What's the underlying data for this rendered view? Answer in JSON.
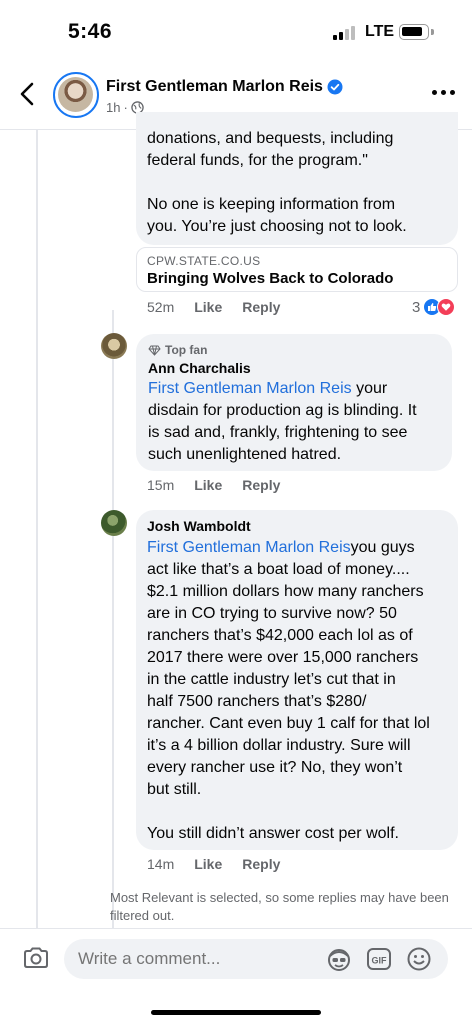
{
  "status_bar": {
    "time": "5:46",
    "network": "LTE"
  },
  "post_header": {
    "author": "First Gentleman Marlon Reis",
    "time": "1h",
    "separator": "·",
    "icons": {
      "back": "chevron-left-icon",
      "verified": "verified-badge-icon",
      "audience": "globe-icon",
      "more": "more-horizontal-icon"
    }
  },
  "comments": [
    {
      "text_lines": [
        "donations, and bequests, including",
        "federal funds, for the program.\"",
        "",
        "No one is keeping information from",
        "you. You’re just choosing not to look."
      ],
      "link_preview": {
        "domain": "CPW.STATE.CO.US",
        "title": "Bringing Wolves Back to Colorado"
      },
      "time": "52m",
      "like_label": "Like",
      "reply_label": "Reply",
      "reactions": {
        "count": "3",
        "types": [
          "like",
          "love"
        ]
      }
    },
    {
      "badge": "Top fan",
      "author": "Ann Charchalis",
      "mention": "First Gentleman Marlon Reis",
      "text_lines": [
        " your",
        "disdain for production ag is blinding.  It",
        "is sad and, frankly, frightening to see",
        "such unenlightened hatred."
      ],
      "time": "15m",
      "like_label": "Like",
      "reply_label": "Reply"
    },
    {
      "author": "Josh Wamboldt",
      "mention": "First Gentleman Marlon Reis",
      "text_lines": [
        "you guys",
        "act like that’s a boat load of money....",
        "$2.1 million dollars how many ranchers",
        "are in CO trying to survive now? 50",
        "ranchers that’s $42,000 each lol as of",
        "2017 there were over 15,000 ranchers",
        "in the cattle industry let’s cut that in",
        "half 7500 ranchers that’s $280/",
        "rancher. Cant even buy 1 calf for that lol",
        "it’s a 4 billion dollar industry.  Sure will",
        "every rancher use it? No, they won’t",
        "but still.",
        "",
        "You still didn’t answer cost per wolf."
      ],
      "time": "14m",
      "like_label": "Like",
      "reply_label": "Reply"
    }
  ],
  "filter_note": "Most Relevant is selected, so some replies may have been filtered out.",
  "composer": {
    "placeholder": "Write a comment...",
    "icons": [
      "camera-icon",
      "avatar-sticker-icon",
      "gif-icon",
      "emoji-icon"
    ]
  },
  "colors": {
    "link_blue": "#216fdb",
    "fb_blue": "#1877f2",
    "bubble_bg": "#f0f2f5",
    "secondary_text": "#65676b"
  }
}
